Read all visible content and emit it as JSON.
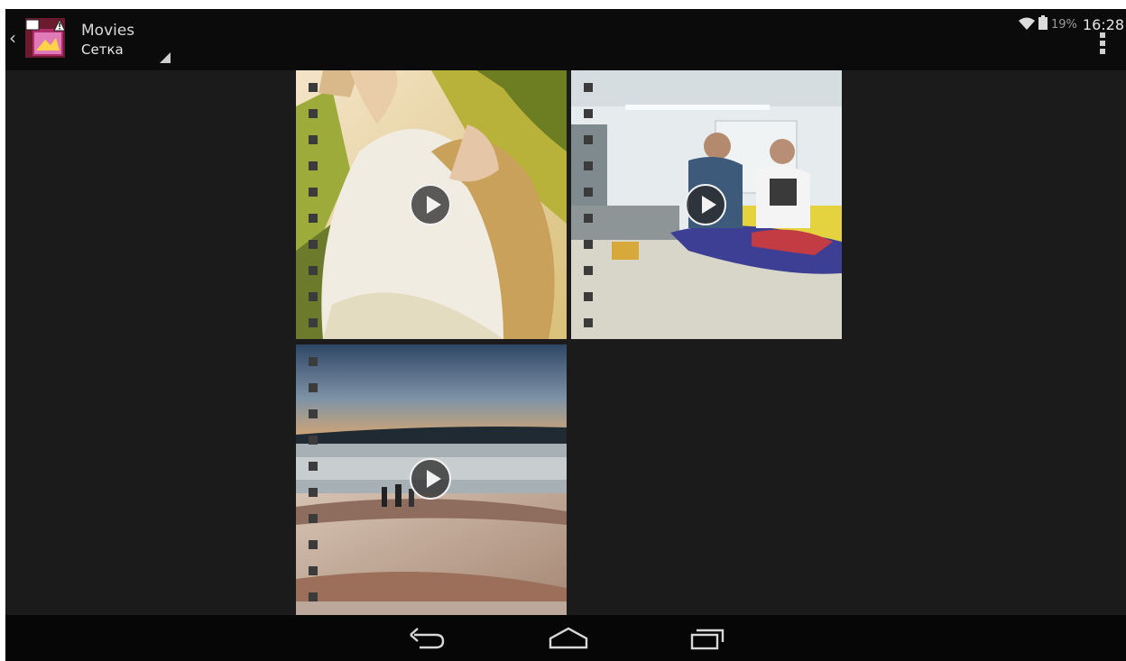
{
  "status_bar": {
    "battery": "19%",
    "time": "16:28",
    "icons": [
      "wifi-icon",
      "battery-icon"
    ]
  },
  "action_bar": {
    "title": "Movies",
    "subtitle": "Сетка",
    "icons": [
      "up-caret-icon",
      "gallery-app-icon",
      "overflow-menu-icon"
    ]
  },
  "videos": [
    {
      "scene": "woman in white dress under tree"
    },
    {
      "scene": "two men with parachute in workshop"
    },
    {
      "scene": "winter landscape at dusk"
    }
  ],
  "navigation": {
    "buttons": [
      "back-icon",
      "home-icon",
      "recents-icon"
    ]
  }
}
